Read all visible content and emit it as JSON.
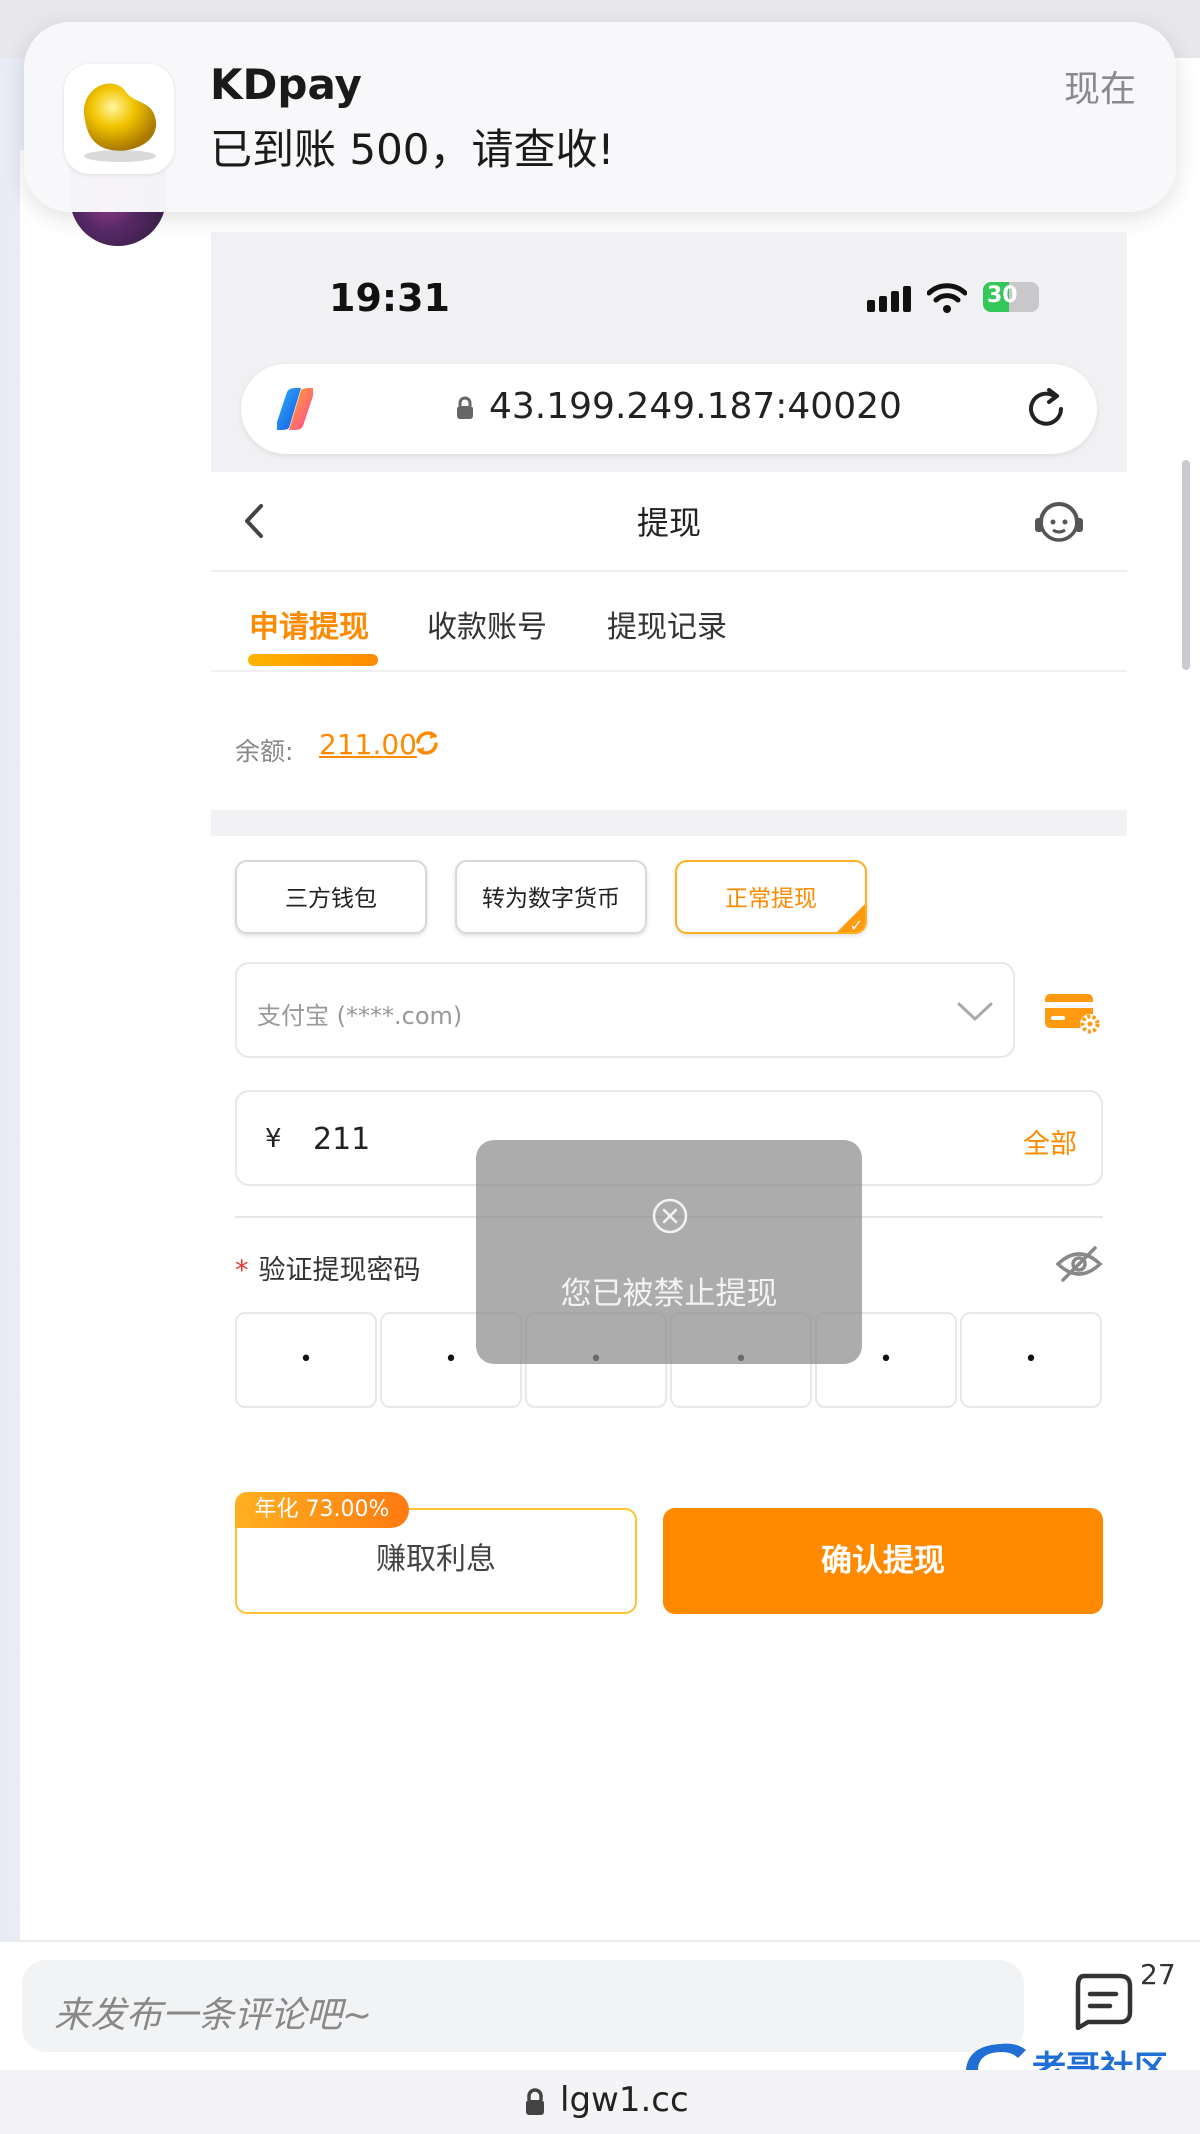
{
  "notification": {
    "app_name": "KDpay",
    "message": "已到账 500，请查收!",
    "time": "现在"
  },
  "status_bar": {
    "time": "19:31",
    "battery": "30"
  },
  "browser": {
    "url": "43.199.249.187:40020"
  },
  "page": {
    "title": "提现"
  },
  "tabs": [
    {
      "label": "申请提现"
    },
    {
      "label": "收款账号"
    },
    {
      "label": "提现记录"
    }
  ],
  "balance": {
    "label": "余额:",
    "value": "211.00"
  },
  "methods": [
    {
      "label": "三方钱包"
    },
    {
      "label": "转为数字货币"
    },
    {
      "label": "正常提现"
    }
  ],
  "account_select": {
    "value": "支付宝 (****.com)"
  },
  "amount": {
    "currency": "¥",
    "value": "211",
    "all_label": "全部"
  },
  "password": {
    "required_mark": "*",
    "label": "验证提现密码",
    "digits": [
      "•",
      "•",
      "•",
      "•",
      "•",
      "•"
    ]
  },
  "toast": {
    "message": "您已被禁止提现"
  },
  "actions": {
    "apy_badge": "年化 73.00%",
    "earn_label": "赚取利息",
    "confirm_label": "确认提现"
  },
  "comment_bar": {
    "placeholder": "来发布一条评论吧~",
    "count": "27"
  },
  "bottom_bar": {
    "domain": "lgw1.cc"
  },
  "colors": {
    "accent": "#ff8a00",
    "toast_bg": "#8c8c8c"
  }
}
